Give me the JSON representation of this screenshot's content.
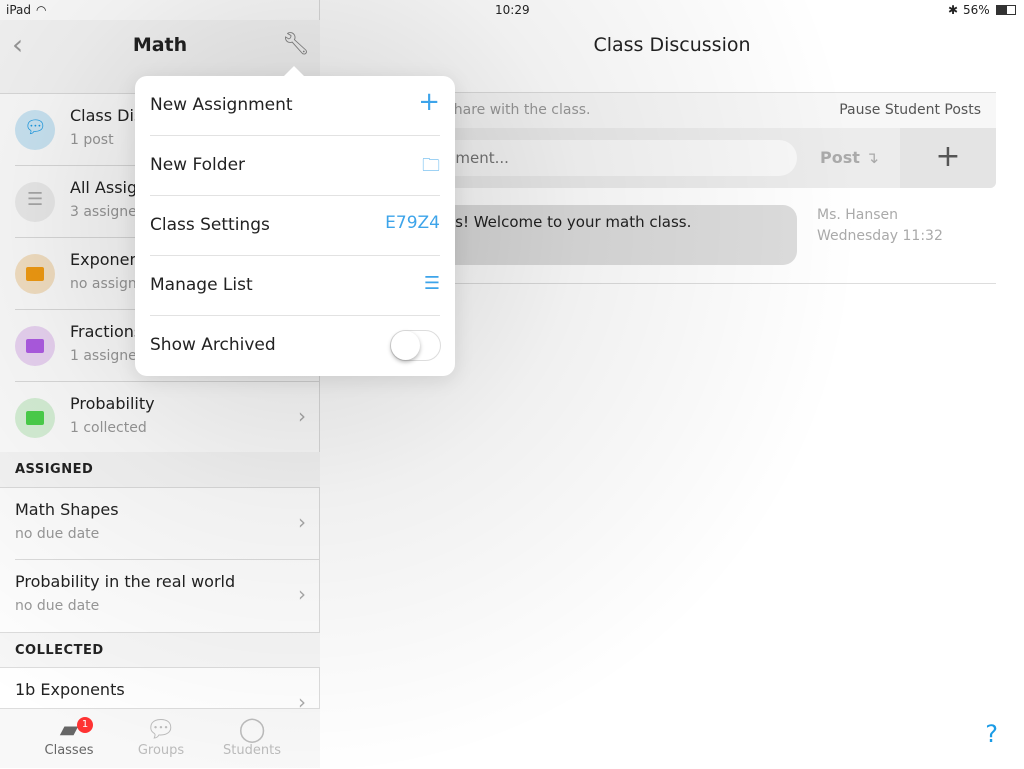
{
  "status": {
    "device": "iPad",
    "time": "10:29",
    "battery": "56%"
  },
  "sidebar": {
    "title": "Math",
    "items": [
      {
        "title": "Class Discussion",
        "sub": "1 post",
        "color": "#1a9be6",
        "bg": "#cde8f7",
        "icon": "chat-bubbles-icon"
      },
      {
        "title": "All Assignments",
        "sub": "3 assigned",
        "color": "#aaa",
        "bg": "#eee",
        "icon": "list-icon"
      },
      {
        "title": "Exponents",
        "sub": "no assignments",
        "color": "#f39c12",
        "bg": "#f7e3c5",
        "icon": "folder-icon"
      },
      {
        "title": "Fractions",
        "sub": "1 assigned",
        "color": "#b05ce6",
        "bg": "#ecd6f5",
        "icon": "folder-icon"
      },
      {
        "title": "Probability",
        "sub": "1 collected",
        "color": "#4cd24c",
        "bg": "#d8f2d8",
        "icon": "folder-icon"
      }
    ],
    "assigned_header": "ASSIGNED",
    "assigned": [
      {
        "title": "Math Shapes",
        "sub": "no due date"
      },
      {
        "title": "Probability in the real world",
        "sub": "no due date"
      }
    ],
    "collected_header": "COLLECTED",
    "collected": [
      {
        "title": "1b Exponents"
      }
    ],
    "tabs": [
      {
        "label": "Classes",
        "badge": "1"
      },
      {
        "label": "Groups"
      },
      {
        "label": "Students"
      }
    ]
  },
  "main": {
    "title": "Class Discussion",
    "info": "Students can share with the class.",
    "pause": "Pause Student Posts",
    "comment_placeholder": "Write a comment...",
    "post": "Post",
    "message": {
      "text": "Hello students! Welcome to your math class.",
      "symbols": "+ − ÷ ×",
      "author": "Ms. Hansen",
      "time": "Wednesday 11:32"
    },
    "help": "?"
  },
  "popover": {
    "new_assignment": "New Assignment",
    "new_folder": "New Folder",
    "class_settings": "Class Settings",
    "class_code": "E79Z4",
    "manage_list": "Manage List",
    "show_archived": "Show Archived",
    "show_archived_on": false,
    "accent": "#3da4ea"
  }
}
